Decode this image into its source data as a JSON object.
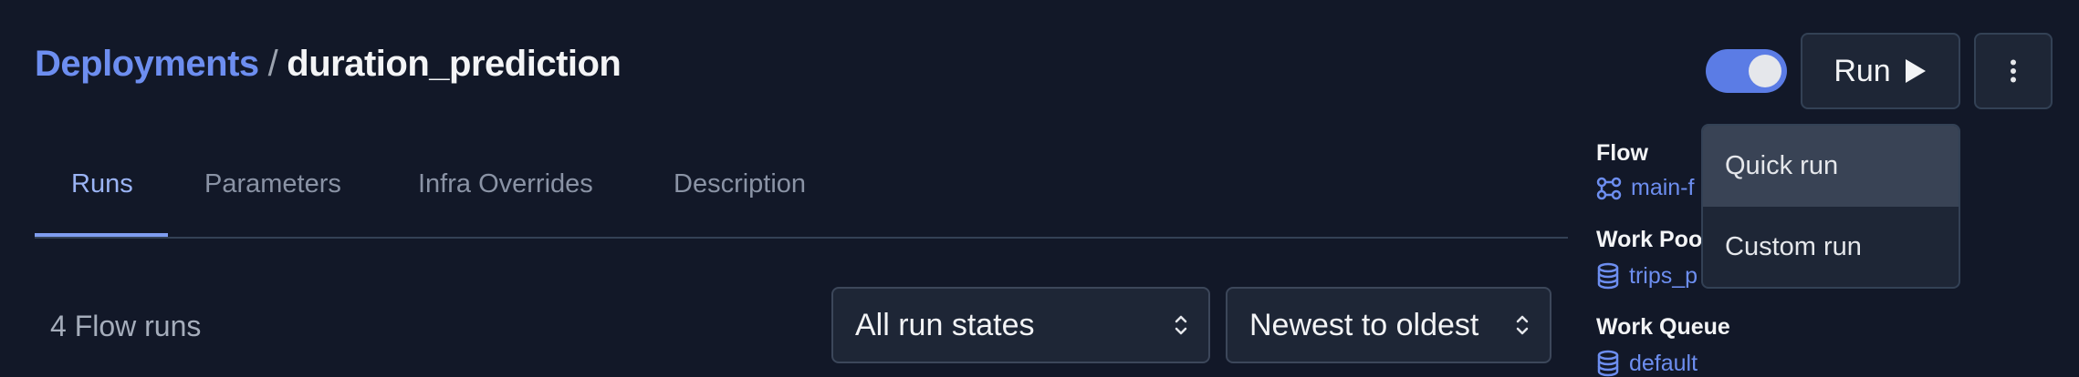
{
  "breadcrumb": {
    "link": "Deployments",
    "separator": "/",
    "current": "duration_prediction"
  },
  "header": {
    "run_label": "Run",
    "toggle_on": true
  },
  "tabs": [
    {
      "label": "Runs",
      "active": true
    },
    {
      "label": "Parameters",
      "active": false
    },
    {
      "label": "Infra Overrides",
      "active": false
    },
    {
      "label": "Description",
      "active": false
    }
  ],
  "runs": {
    "count_text": "4 Flow runs"
  },
  "filters": {
    "state_value": "All run states",
    "sort_value": "Newest to oldest"
  },
  "sidebar": {
    "flow_label": "Flow",
    "flow_value": "main-f",
    "work_pool_label": "Work Pool",
    "work_pool_value": "trips_p",
    "work_queue_label": "Work Queue",
    "work_queue_value": "default"
  },
  "run_menu": {
    "items": [
      "Quick run",
      "Custom run"
    ]
  },
  "icons": {
    "flow": "flow-icon",
    "database": "database-icon",
    "play": "play-icon",
    "more": "kebab-icon",
    "chevrons": "chevron-up-down-icon"
  },
  "colors": {
    "background": "#121828",
    "accent": "#6d8ef0",
    "toggle": "#5b7ce5",
    "surface": "#1e2636"
  }
}
